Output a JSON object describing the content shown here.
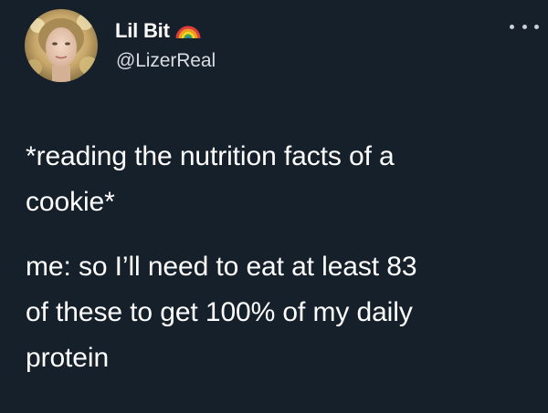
{
  "tweet": {
    "author": {
      "display_name": "Lil Bit",
      "handle": "@LizerReal",
      "badge_icon": "rainbow-icon"
    },
    "more_icon": "more-options-icon",
    "text": {
      "paragraph1": [
        "*reading the nutrition facts of a",
        "cookie*"
      ],
      "paragraph2": [
        "me: so I’ll need to eat at least 83",
        "of these to get 100% of my daily",
        "protein"
      ]
    }
  },
  "colors": {
    "background": "#15202b",
    "text": "#ffffff",
    "secondary_text": "#d9dde2"
  }
}
